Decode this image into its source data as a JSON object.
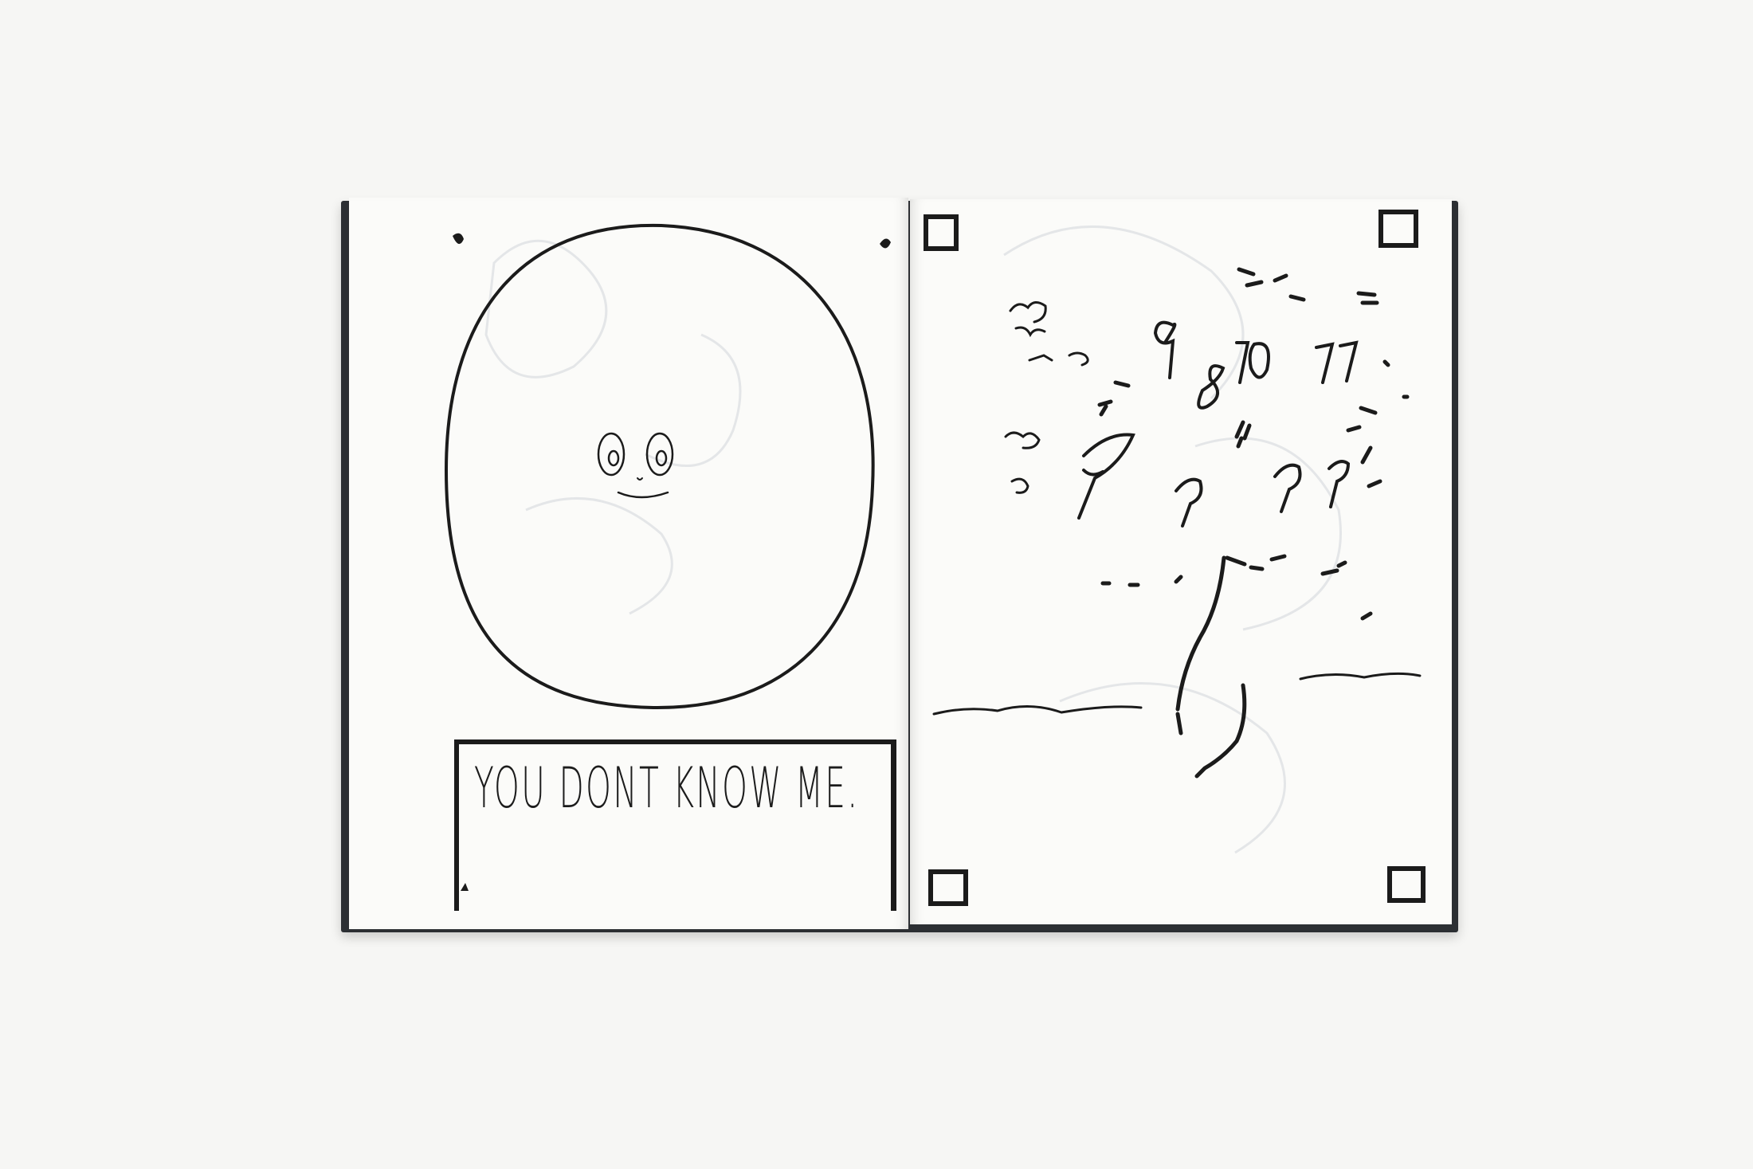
{
  "sketchbook": {
    "left_page": {
      "caption": "YOU DONT KNOW ME."
    },
    "right_page": {
      "numbers": [
        "9",
        "8",
        "10",
        "11"
      ]
    }
  },
  "colors": {
    "background": "#f6f6f4",
    "cover": "#2c2f33",
    "paper": "#fbfbf9",
    "ink": "#1b1b1b"
  }
}
